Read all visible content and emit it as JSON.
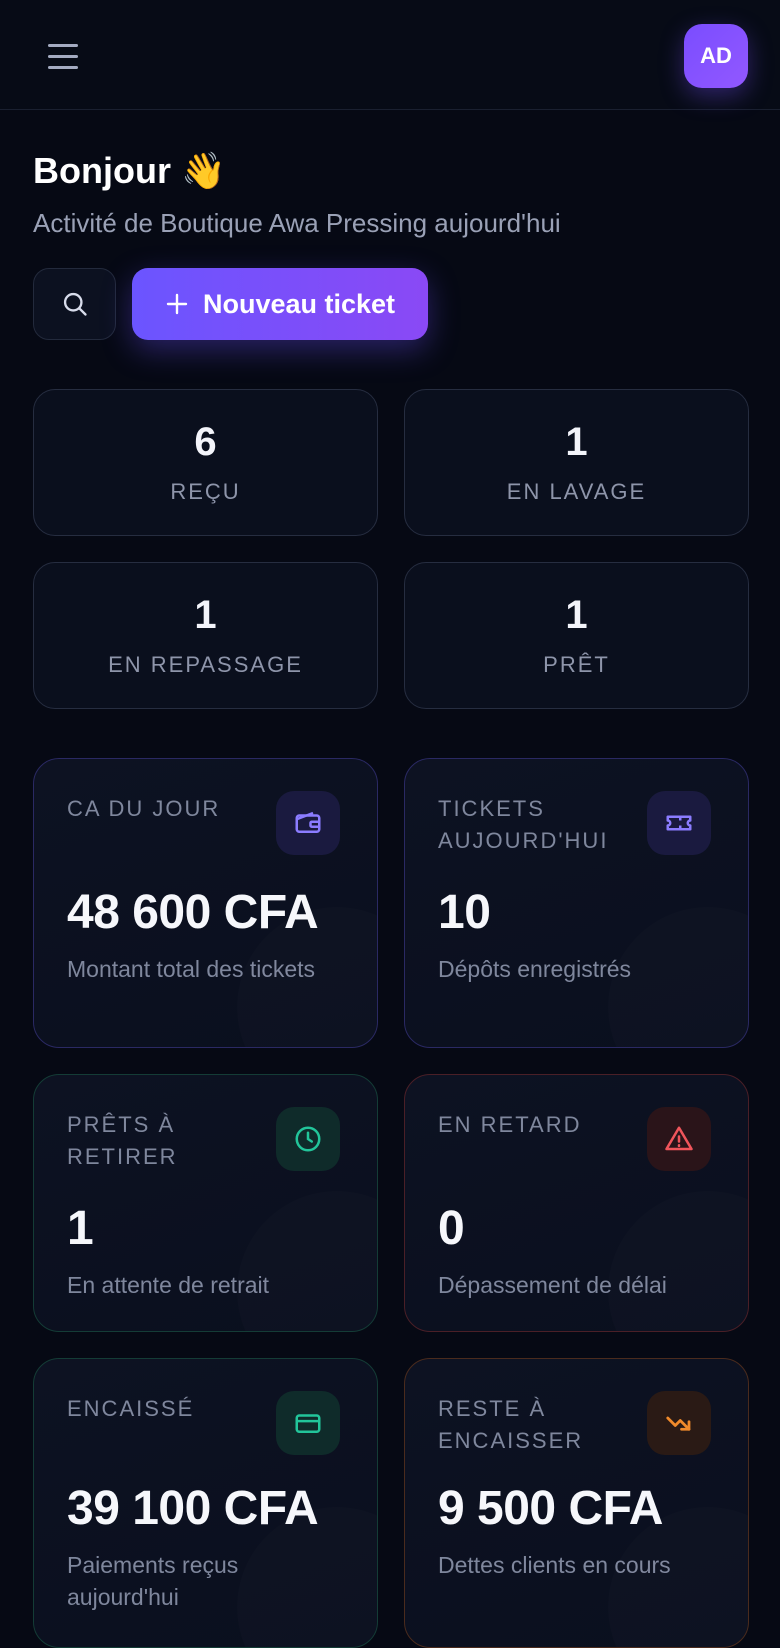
{
  "header": {
    "avatar_initials": "AD"
  },
  "greeting": {
    "title": "Bonjour 👋",
    "subtitle": "Activité de Boutique Awa Pressing aujourd'hui"
  },
  "actions": {
    "new_ticket_label": "Nouveau ticket"
  },
  "status_counts": [
    {
      "count": "6",
      "label": "REÇU"
    },
    {
      "count": "1",
      "label": "EN LAVAGE"
    },
    {
      "count": "1",
      "label": "EN REPASSAGE"
    },
    {
      "count": "1",
      "label": "PRÊT"
    }
  ],
  "kpis": [
    {
      "title": "CA DU JOUR",
      "value": "48 600 CFA",
      "subtitle": "Montant total des tickets",
      "icon": "wallet-icon",
      "color": "#8b7cff"
    },
    {
      "title": "TICKETS AUJOURD'HUI",
      "value": "10",
      "subtitle": "Dépôts enregistrés",
      "icon": "ticket-icon",
      "color": "#8b7cff"
    },
    {
      "title": "PRÊTS À RETIRER",
      "value": "1",
      "subtitle": "En attente de retrait",
      "icon": "clock-icon",
      "color": "#22c59a"
    },
    {
      "title": "EN RETARD",
      "value": "0",
      "subtitle": "Dépassement de délai",
      "icon": "alert-triangle-icon",
      "color": "#f0555b"
    },
    {
      "title": "ENCAISSÉ",
      "value": "39 100 CFA",
      "subtitle": "Paiements reçus aujourd'hui",
      "icon": "credit-card-icon",
      "color": "#22c59a"
    },
    {
      "title": "RESTE À ENCAISSER",
      "value": "9 500 CFA",
      "subtitle": "Dettes clients en cours",
      "icon": "trending-down-icon",
      "color": "#f08a2b"
    }
  ]
}
